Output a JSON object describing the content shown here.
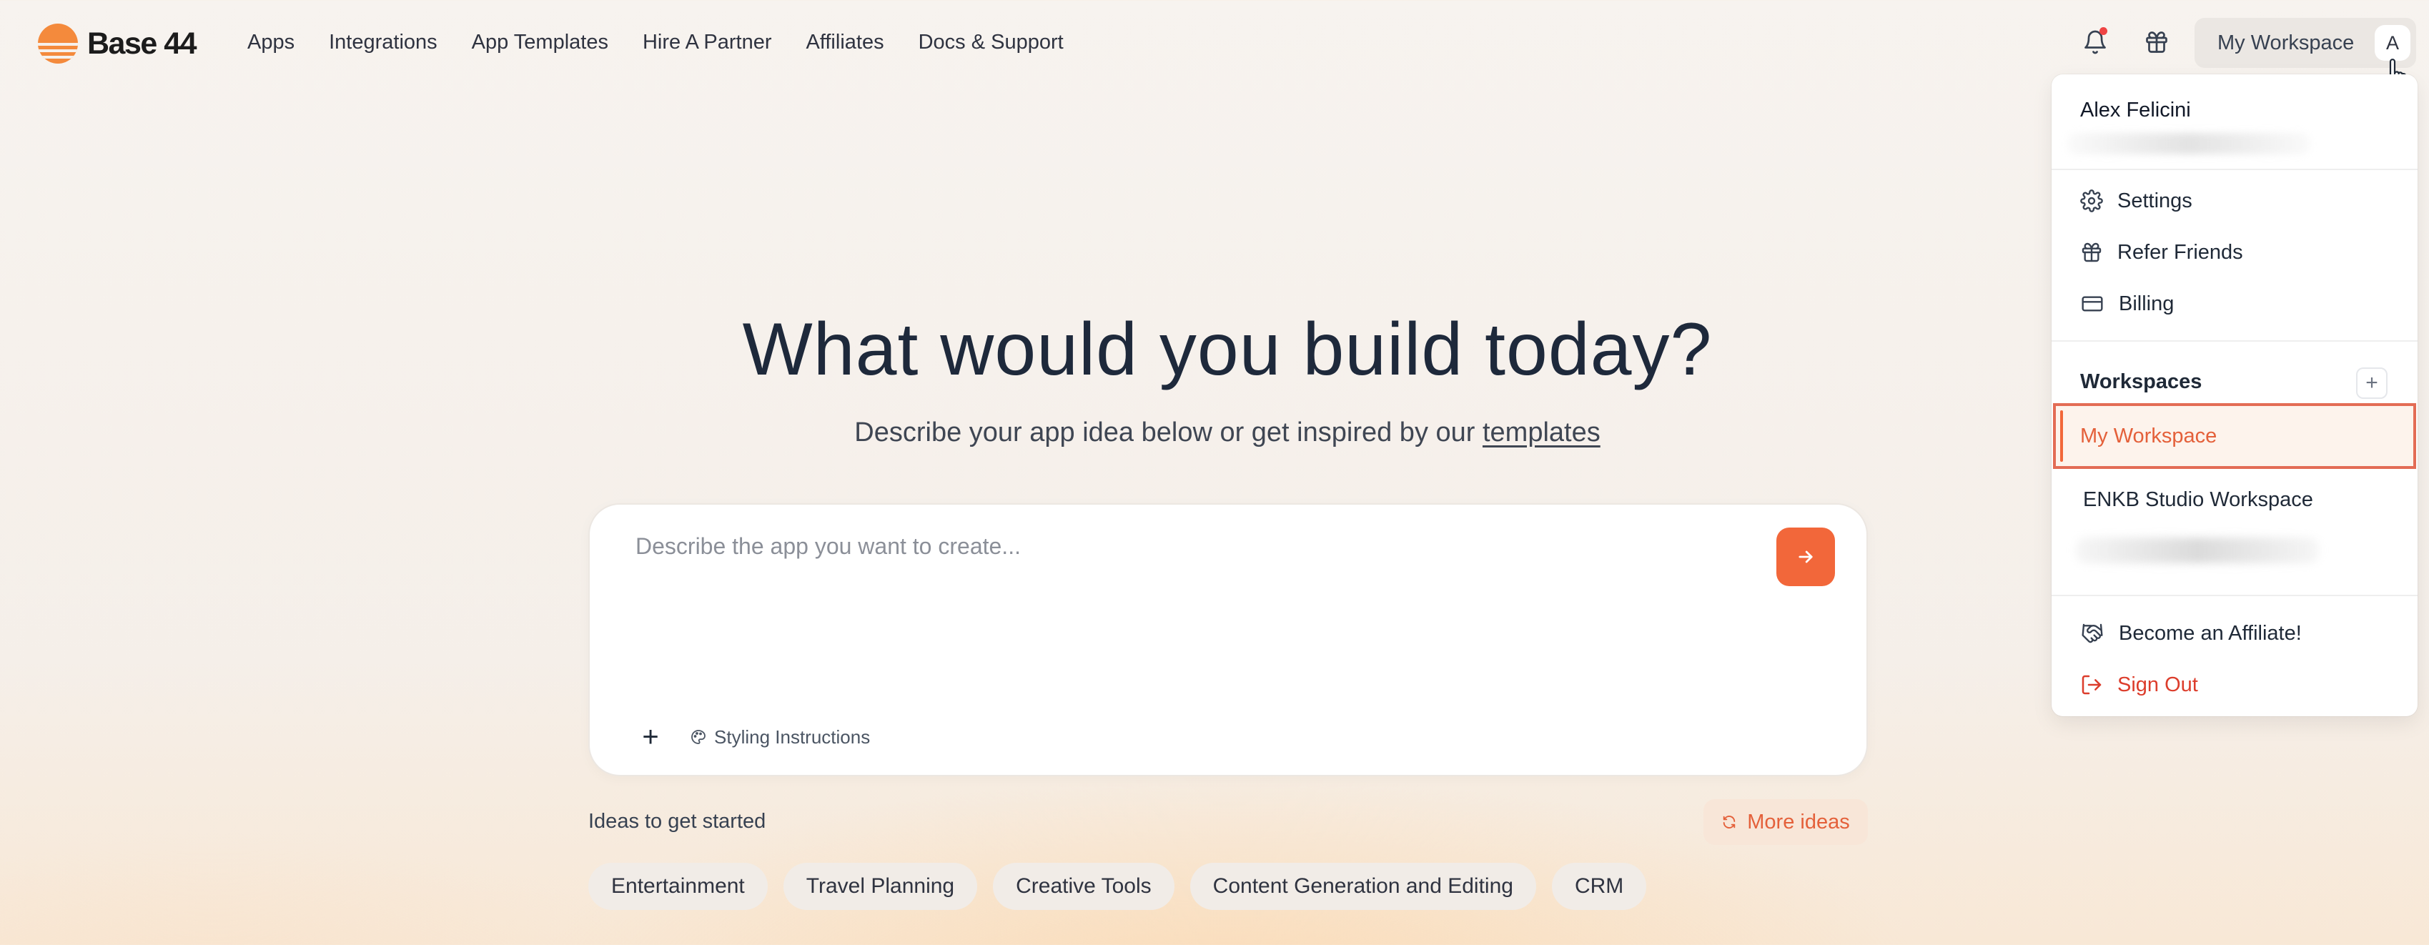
{
  "brand": {
    "name": "Base 44",
    "accent": "#f2673a"
  },
  "nav": {
    "items": [
      {
        "label": "Apps"
      },
      {
        "label": "Integrations"
      },
      {
        "label": "App Templates"
      },
      {
        "label": "Hire A Partner"
      },
      {
        "label": "Affiliates"
      },
      {
        "label": "Docs & Support"
      }
    ]
  },
  "header": {
    "workspace_label": "My Workspace",
    "avatar_initial": "A",
    "icons": [
      "bell-icon",
      "gift-icon"
    ]
  },
  "hero": {
    "title": "What would you build today?",
    "subtitle_prefix": "Describe your app idea below or get inspired by our",
    "subtitle_link": "templates"
  },
  "prompt": {
    "placeholder": "Describe the app you want to create...",
    "value": "",
    "add_label": "+",
    "styling_label": "Styling Instructions"
  },
  "ideas": {
    "label": "Ideas to get started",
    "more_label": "More ideas",
    "chips": [
      {
        "label": "Entertainment"
      },
      {
        "label": "Travel Planning"
      },
      {
        "label": "Creative Tools"
      },
      {
        "label": "Content Generation and Editing"
      },
      {
        "label": "CRM"
      }
    ]
  },
  "menu": {
    "user_name": "Alex Felicini",
    "items": [
      {
        "label": "Settings",
        "icon": "gear-icon"
      },
      {
        "label": "Refer Friends",
        "icon": "gift-icon"
      },
      {
        "label": "Billing",
        "icon": "credit-card-icon"
      }
    ],
    "workspaces_title": "Workspaces",
    "workspaces_add": "+",
    "workspaces": [
      {
        "label": "My Workspace",
        "active": true
      },
      {
        "label": "ENKB Studio Workspace",
        "active": false
      }
    ],
    "affiliate_label": "Become an Affiliate!",
    "signout_label": "Sign Out",
    "signout_color": "#dc3d2c"
  }
}
